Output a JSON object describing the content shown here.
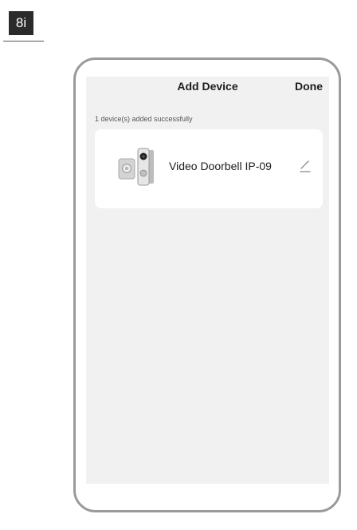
{
  "step_badge": "8i",
  "nav": {
    "title": "Add Device",
    "done_label": "Done"
  },
  "status_message": "1 device(s) added successfully",
  "device": {
    "name": "Video Doorbell IP-09",
    "icon": "doorbell-device-image",
    "edit_icon": "edit-pencil-icon"
  },
  "colors": {
    "screen_background": "#f1f1f1",
    "card_background": "#ffffff",
    "frame_border": "#9a9a9a",
    "badge_background": "#2b2b2b"
  }
}
